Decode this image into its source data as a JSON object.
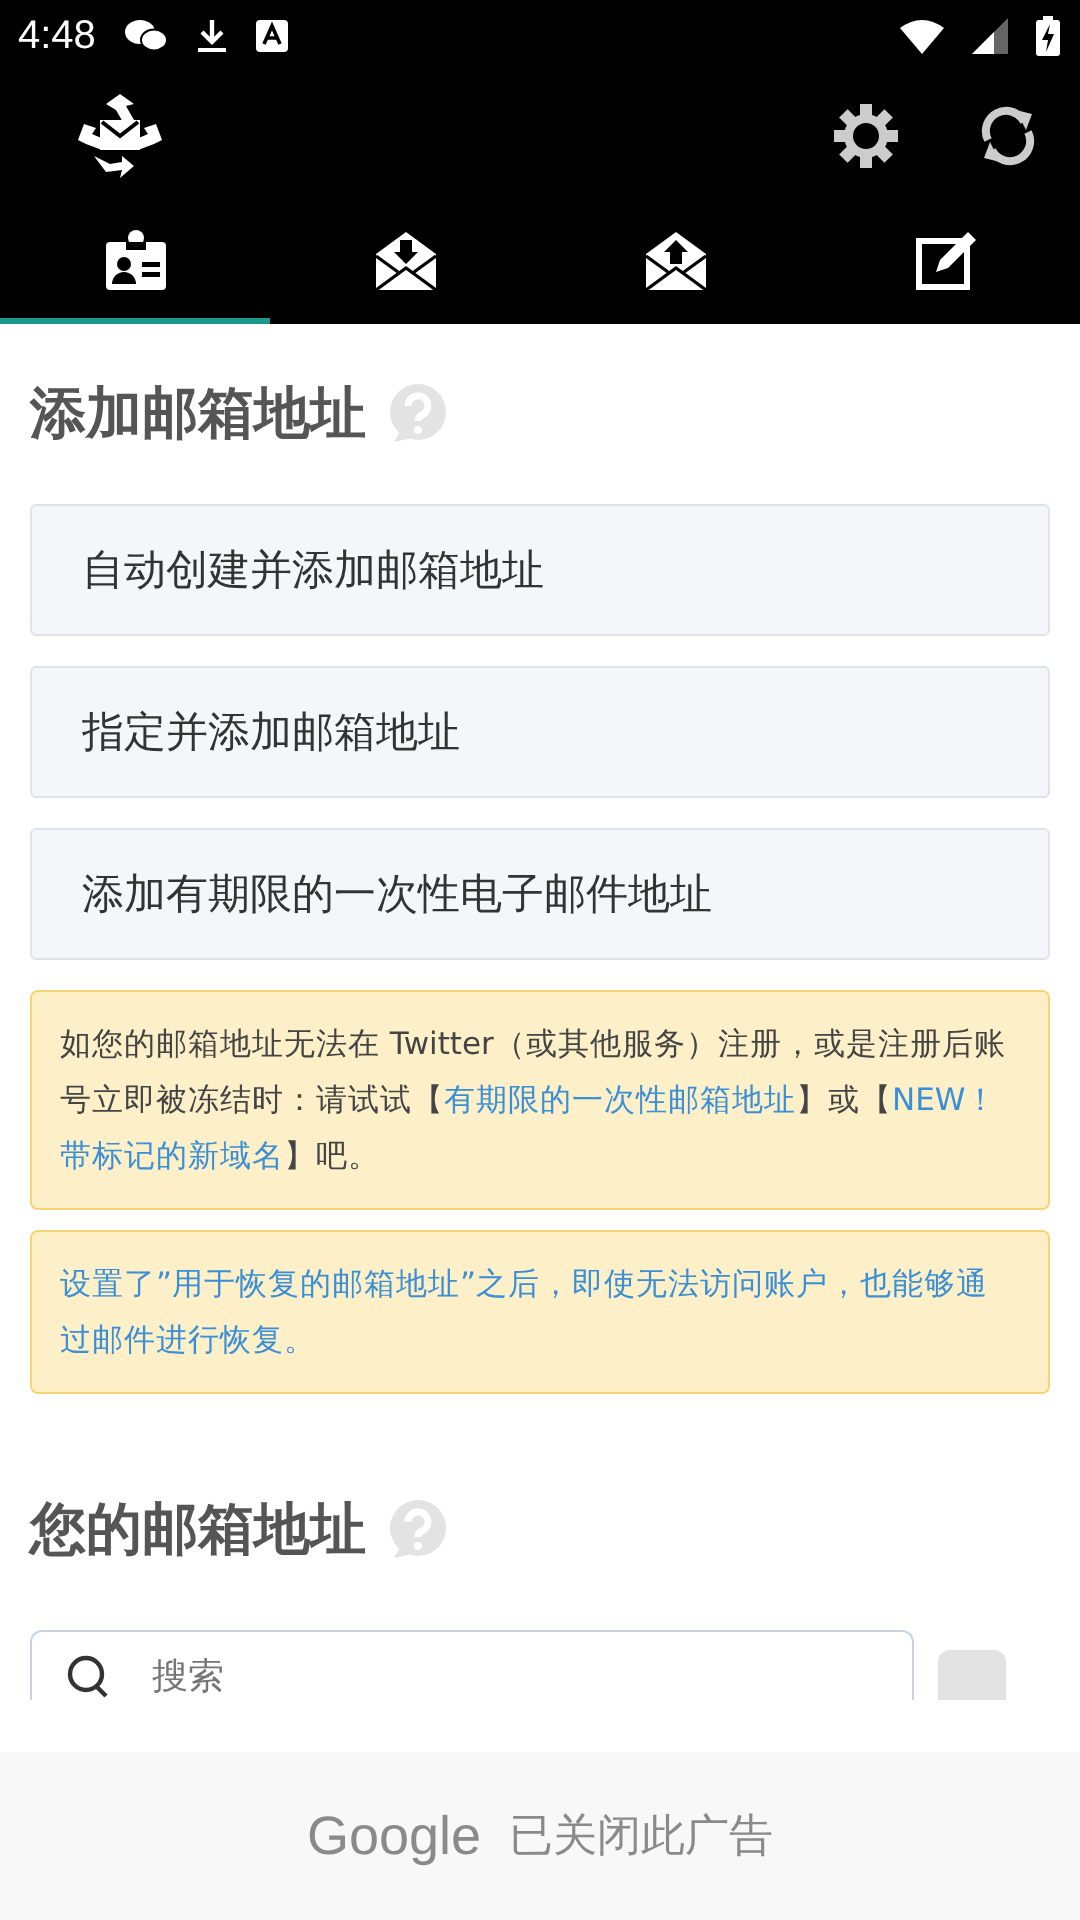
{
  "status_bar": {
    "time": "4:48"
  },
  "tabs": [
    {
      "kind": "contact",
      "selected": true
    },
    {
      "kind": "inbox",
      "selected": false
    },
    {
      "kind": "outbox",
      "selected": false
    },
    {
      "kind": "compose",
      "selected": false
    }
  ],
  "add_section": {
    "title": "添加邮箱地址",
    "buttons": [
      "自动创建并添加邮箱地址",
      "指定并添加邮箱地址",
      "添加有期限的一次性电子邮件地址"
    ]
  },
  "notes": [
    {
      "segments": [
        {
          "text": "如您的邮箱地址无法在 Twitter（或其他服务）注册，或是注册后账号立即被冻结时：请试试【",
          "link": false
        },
        {
          "text": "有期限的一次性邮箱地址",
          "link": true
        },
        {
          "text": "】或【",
          "link": false
        },
        {
          "text": "NEW！带标记的新域名",
          "link": true
        },
        {
          "text": "】吧。",
          "link": false
        }
      ]
    },
    {
      "segments": [
        {
          "text": "设置了”用于恢复的邮箱地址”之后，即使无法访问账户，也能够通过邮件进行恢复。",
          "link": true
        }
      ]
    }
  ],
  "address_section": {
    "title": "您的邮箱地址",
    "search": {
      "placeholder": "搜索"
    }
  },
  "ad_banner": {
    "brand": "Google",
    "message": "已关闭此广告"
  }
}
